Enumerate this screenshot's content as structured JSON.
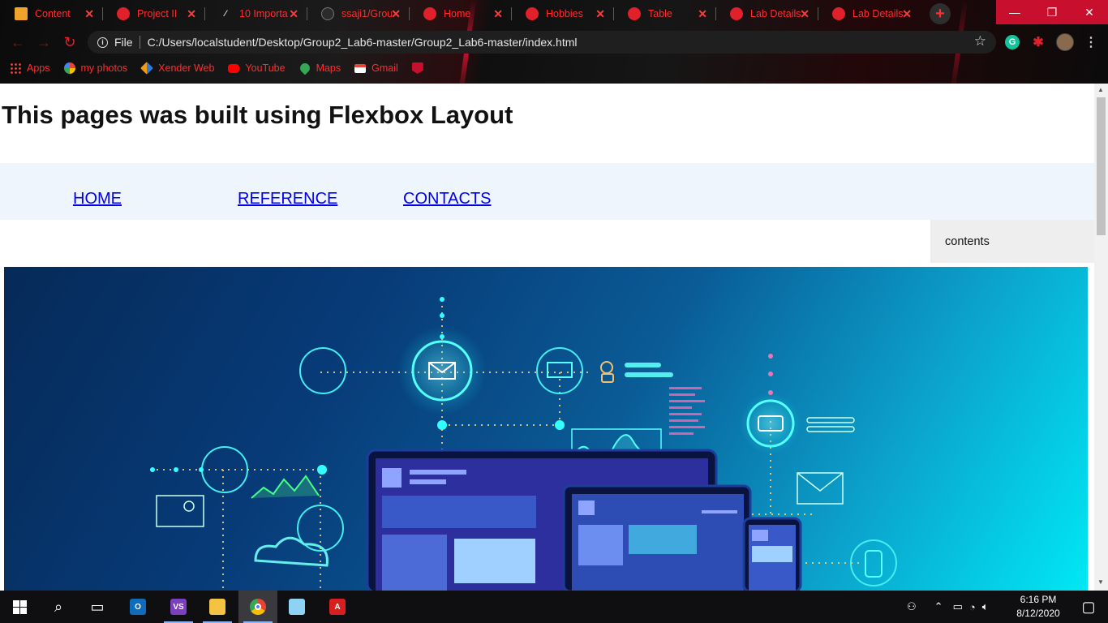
{
  "browser": {
    "tabs": [
      {
        "label": "Content",
        "icon": "note-icon"
      },
      {
        "label": "Project II",
        "icon": "globe-icon"
      },
      {
        "label": "10 Importa",
        "icon": "ten-icon"
      },
      {
        "label": "ssaji1/Grou",
        "icon": "github-icon"
      },
      {
        "label": "Home",
        "icon": "globe-icon"
      },
      {
        "label": "Hobbies",
        "icon": "globe-icon"
      },
      {
        "label": "Table",
        "icon": "globe-icon"
      },
      {
        "label": "Lab Details",
        "icon": "globe-icon"
      },
      {
        "label": "Lab Details",
        "icon": "globe-icon"
      }
    ],
    "address": {
      "scheme_label": "File",
      "url": "C:/Users/localstudent/Desktop/Group2_Lab6-master/Group2_Lab6-master/index.html"
    },
    "bookmarks": [
      {
        "label": "Apps",
        "icon": "apps-icon"
      },
      {
        "label": "my photos",
        "icon": "photos-icon"
      },
      {
        "label": "Xender Web",
        "icon": "xender-icon"
      },
      {
        "label": "YouTube",
        "icon": "youtube-icon"
      },
      {
        "label": "Maps",
        "icon": "maps-icon"
      },
      {
        "label": "Gmail",
        "icon": "gmail-icon"
      },
      {
        "label": "",
        "icon": "mcafee-icon"
      }
    ],
    "extensions": {
      "grammarly": "G"
    },
    "accent_color": "#ff2d2d"
  },
  "page": {
    "title": "This pages was built using Flexbox Layout",
    "nav": {
      "home": "HOME",
      "reference": "REFERENCE",
      "contacts": "CONTACTS"
    },
    "aside_text": "contents",
    "hero_image": "technology-dashboard-illustration",
    "navbar_bg": "#eef5fc",
    "link_color": "#0000ee"
  },
  "taskbar": {
    "apps": [
      "windows-start-icon",
      "search-icon",
      "task-view-icon",
      "outlook-icon",
      "visual-studio-icon",
      "file-explorer-icon",
      "chrome-icon",
      "notepad-icon",
      "acrobat-icon"
    ],
    "clock": {
      "time": "6:16 PM",
      "date": "8/12/2020"
    }
  }
}
